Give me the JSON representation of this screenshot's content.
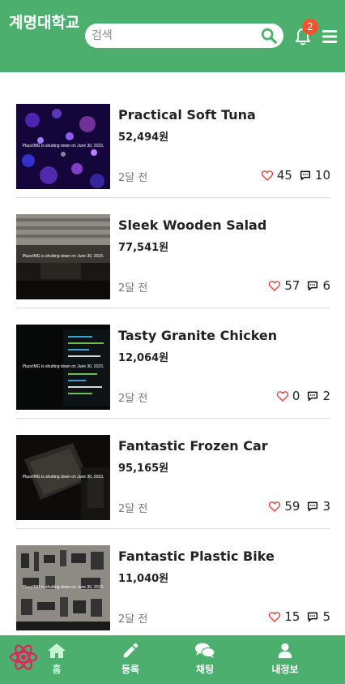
{
  "header": {
    "brand": "계명대학교",
    "search_placeholder": "검색",
    "notification_count": "2"
  },
  "products": [
    {
      "title": "Practical Soft Tuna",
      "price": "52,494원",
      "time": "2달 전",
      "likes": "45",
      "comments": "10",
      "thumb_caption": "PlaceIMG is shutting down on June 30, 2023."
    },
    {
      "title": "Sleek Wooden Salad",
      "price": "77,541원",
      "time": "2달 전",
      "likes": "57",
      "comments": "6",
      "thumb_caption": "PlaceIMG is shutting down on June 30, 2023."
    },
    {
      "title": "Tasty Granite Chicken",
      "price": "12,064원",
      "time": "2달 전",
      "likes": "0",
      "comments": "2",
      "thumb_caption": "PlaceIMG is shutting down on June 30, 2023."
    },
    {
      "title": "Fantastic Frozen Car",
      "price": "95,165원",
      "time": "2달 전",
      "likes": "59",
      "comments": "3",
      "thumb_caption": "PlaceIMG is shutting down on June 30, 2023."
    },
    {
      "title": "Fantastic Plastic Bike",
      "price": "11,040원",
      "time": "2달 전",
      "likes": "15",
      "comments": "5",
      "thumb_caption": "PlaceIMG is shutting down on June 30, 2023."
    }
  ],
  "nav": {
    "home": "홈",
    "register": "등록",
    "chat": "채팅",
    "profile": "내정보"
  },
  "colors": {
    "brand_green": "#4caf6e",
    "badge_red": "#f2542d",
    "heart_red": "#e53935"
  },
  "icons": [
    "search-icon",
    "bell-icon",
    "menu-icon",
    "heart-icon",
    "chat-bubble-icon",
    "react-logo-icon",
    "home-icon",
    "pencil-icon",
    "chat-icon",
    "user-icon"
  ]
}
